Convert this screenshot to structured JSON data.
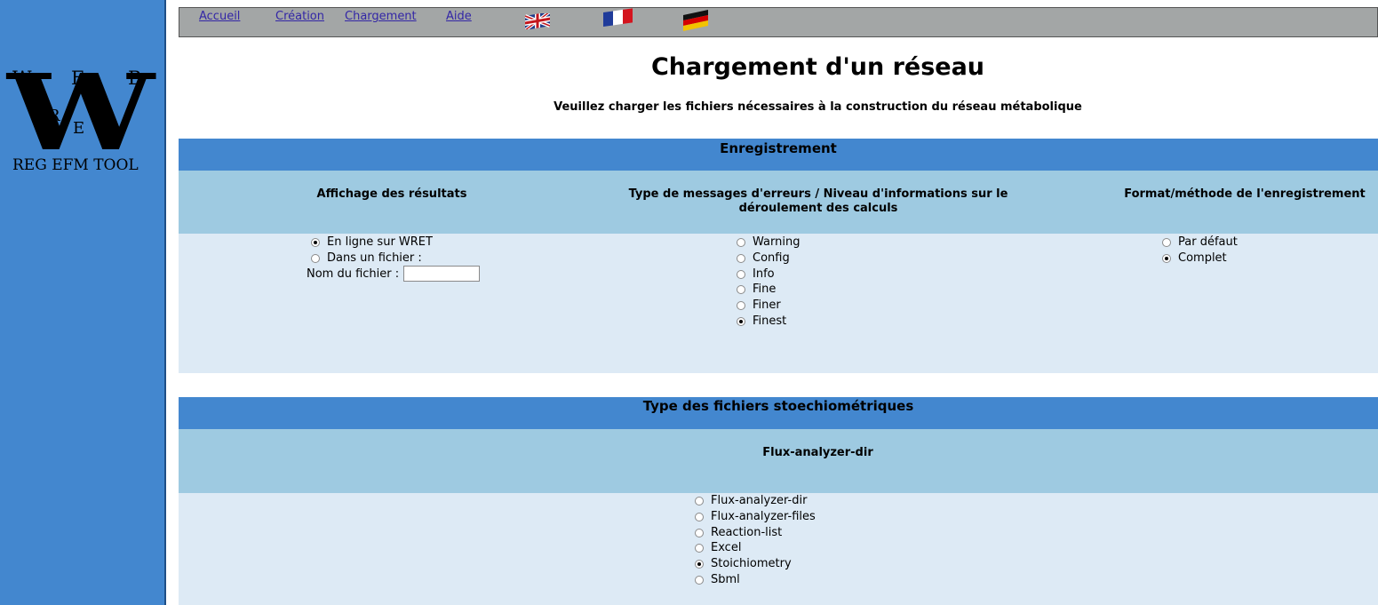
{
  "logo": {
    "letters": [
      "W",
      "E",
      "B",
      "R",
      "E",
      "T"
    ],
    "big_letter": "W",
    "tagline": "REG EFM TOOL"
  },
  "nav": {
    "items": [
      "Accueil",
      "Création",
      "Chargement",
      "Aide"
    ],
    "flags": [
      "english-flag-icon",
      "french-flag-icon",
      "german-flag-icon"
    ]
  },
  "page": {
    "title": "Chargement d'un réseau",
    "subtitle": "Veuillez charger les fichiers nécessaires à la construction du réseau métabolique"
  },
  "enregistrement": {
    "title": "Enregistrement",
    "columns": [
      "Affichage des résultats",
      "Type de messages d'erreurs / Niveau d'informations sur le déroulement des calculs",
      "Format/méthode de l'enregistrement"
    ],
    "affichage": {
      "options": [
        {
          "label": "En ligne sur WRET",
          "checked": true
        },
        {
          "label": "Dans un fichier :",
          "checked": false
        }
      ],
      "filename_label": "Nom du fichier :",
      "filename_value": ""
    },
    "messages": {
      "options": [
        {
          "label": "Warning",
          "checked": false
        },
        {
          "label": "Config",
          "checked": false
        },
        {
          "label": "Info",
          "checked": false
        },
        {
          "label": "Fine",
          "checked": false
        },
        {
          "label": "Finer",
          "checked": false
        },
        {
          "label": "Finest",
          "checked": true
        }
      ]
    },
    "format": {
      "options": [
        {
          "label": "Par défaut",
          "checked": false
        },
        {
          "label": "Complet",
          "checked": true
        }
      ]
    }
  },
  "stoechio": {
    "title": "Type des fichiers stoechiométriques",
    "column": "Flux-analyzer-dir",
    "options": [
      {
        "label": "Flux-analyzer-dir",
        "checked": false
      },
      {
        "label": "Flux-analyzer-files",
        "checked": false
      },
      {
        "label": "Reaction-list",
        "checked": false
      },
      {
        "label": "Excel",
        "checked": false
      },
      {
        "label": "Stoichiometry",
        "checked": true
      },
      {
        "label": "Sbml",
        "checked": false
      }
    ]
  },
  "colors": {
    "sidebar": "#4387cf",
    "section_header": "#4387cf",
    "column_header": "#9ecae1",
    "section_body": "#ddeaf5",
    "nav_bar": "#a3a6a6",
    "link": "#3326a6"
  }
}
